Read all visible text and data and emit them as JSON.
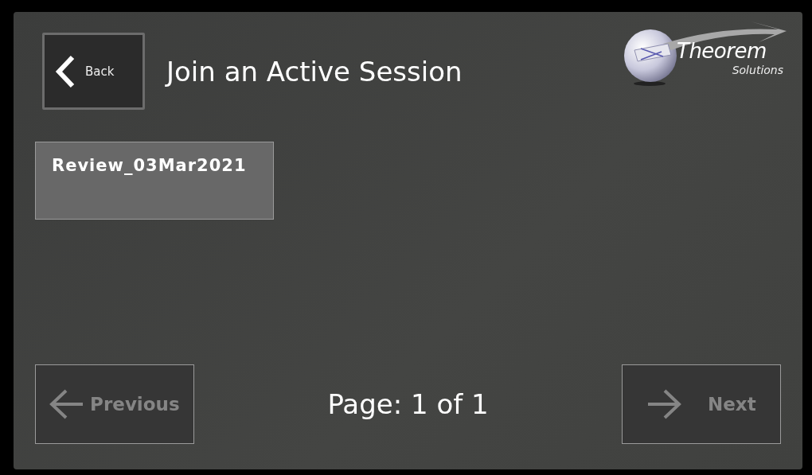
{
  "header": {
    "back_button": {
      "label": "Back"
    },
    "title": "Join an Active Session",
    "logo": {
      "name": "Theorem",
      "tagline": "Solutions"
    }
  },
  "sessions": [
    {
      "label": "Review_03Mar2021"
    }
  ],
  "pagination": {
    "previous": {
      "label": "Previous",
      "disabled": true
    },
    "page": "Page: 1 of 1",
    "next": {
      "label": "Next",
      "disabled": true
    }
  }
}
